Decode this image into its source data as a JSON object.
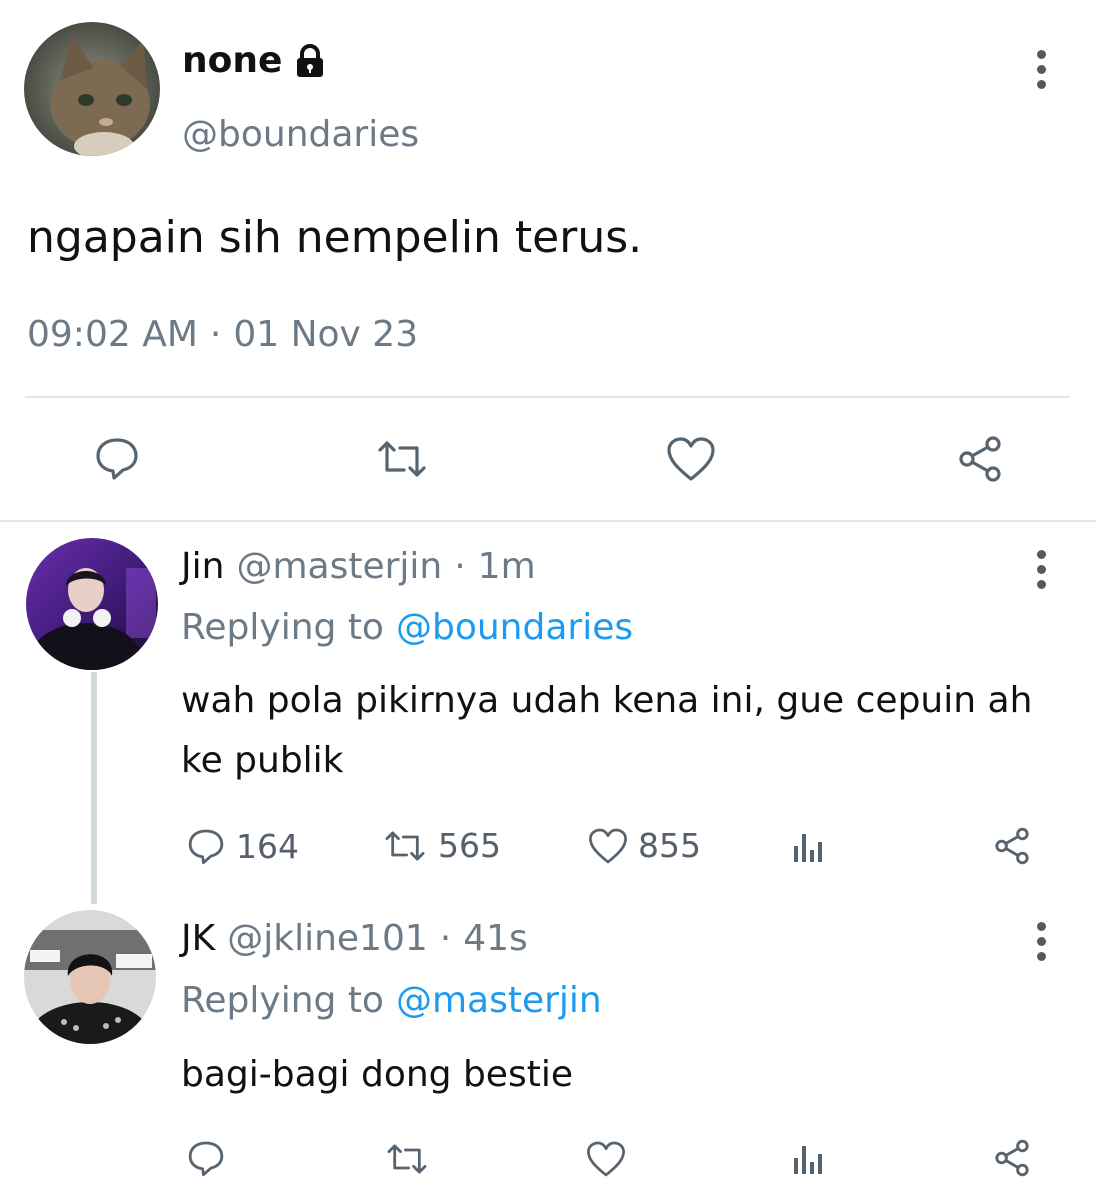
{
  "tweet": {
    "display_name": "none",
    "lock_icon": "lock-icon",
    "handle": "@boundaries",
    "text": "ngapain sih nempelin terus.",
    "time": "09:02 AM",
    "separator": "·",
    "date": "01 Nov 23",
    "actions": [
      "reply-icon",
      "retweet-icon",
      "like-icon",
      "share-icon"
    ]
  },
  "replies": [
    {
      "name": "Jin",
      "handle": "@masterjin",
      "separator": "·",
      "age": "1m",
      "replying_prefix": "Replying to",
      "replying_handle": "@boundaries",
      "text_line1": "wah pola pikirnya udah kena ini, gue cepuin ah",
      "text_line2": "ke publik",
      "reply_count": "164",
      "retweet_count": "565",
      "like_count": "855"
    },
    {
      "name": "JK",
      "handle": "@jkline101",
      "separator": "·",
      "age": "41s",
      "replying_prefix": "Replying to",
      "replying_handle": "@masterjin",
      "text_line1": "bagi-bagi dong bestie"
    }
  ],
  "colors": {
    "accent": "#1d9bf0",
    "muted": "#6b7a86",
    "divider": "#e3e6e8",
    "thread_line": "#cfd9de"
  }
}
